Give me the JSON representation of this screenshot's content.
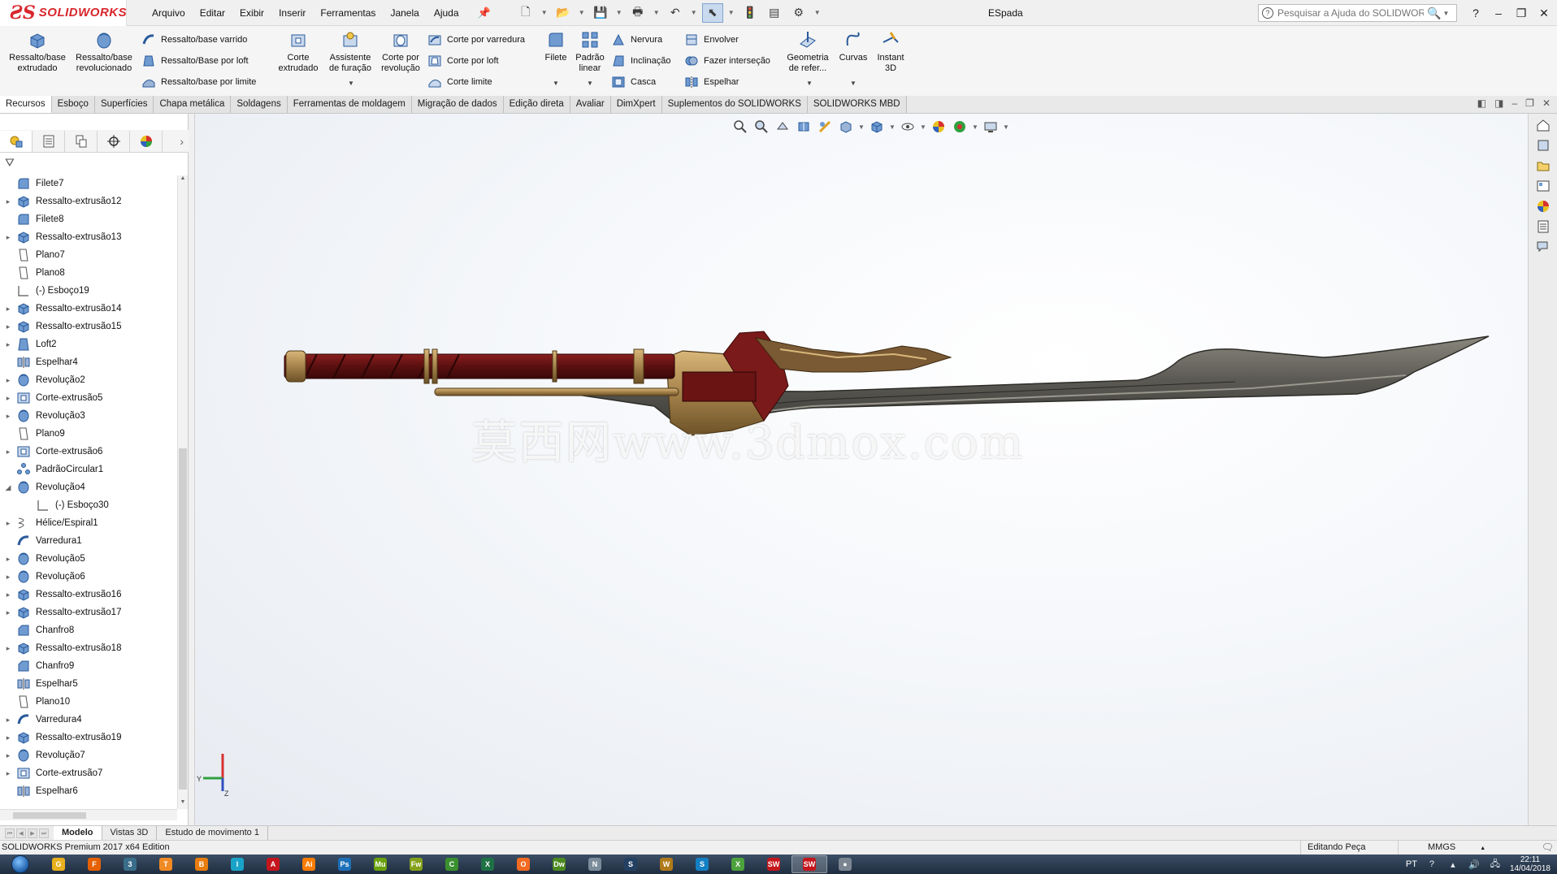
{
  "app": {
    "logo_text": "SOLIDWORKS",
    "document_title": "ESpada",
    "menu": [
      "Arquivo",
      "Editar",
      "Exibir",
      "Inserir",
      "Ferramentas",
      "Janela",
      "Ajuda"
    ],
    "help_search_placeholder": "Pesquisar a Ajuda do SOLIDWORKS"
  },
  "ribbon": {
    "big_buttons": [
      {
        "label": "Ressalto/base extrudado",
        "icon": "extrude-boss-icon"
      },
      {
        "label": "Ressalto/base revolucionado",
        "icon": "revolve-boss-icon"
      },
      {
        "label": "Corte extrudado",
        "icon": "extrude-cut-icon"
      },
      {
        "label": "Assistente de furação",
        "icon": "hole-wizard-icon"
      },
      {
        "label": "Corte por revolução",
        "icon": "revolve-cut-icon"
      },
      {
        "label": "Filete",
        "icon": "fillet-icon"
      },
      {
        "label": "Padrão linear",
        "icon": "linear-pattern-icon"
      },
      {
        "label": "Geometria de refer...",
        "icon": "reference-geometry-icon"
      },
      {
        "label": "Curvas",
        "icon": "curves-icon"
      },
      {
        "label": "Instant 3D",
        "icon": "instant3d-icon"
      }
    ],
    "small_buttons": [
      {
        "label": "Ressalto/base varrido",
        "icon": "swept-boss-icon"
      },
      {
        "label": "Ressalto/Base por loft",
        "icon": "loft-boss-icon"
      },
      {
        "label": "Ressalto/base por limite",
        "icon": "boundary-boss-icon"
      },
      {
        "label": "Corte por varredura",
        "icon": "swept-cut-icon"
      },
      {
        "label": "Corte por loft",
        "icon": "lofted-cut-icon"
      },
      {
        "label": "Corte limite",
        "icon": "boundary-cut-icon"
      },
      {
        "label": "Nervura",
        "icon": "rib-icon"
      },
      {
        "label": "Inclinação",
        "icon": "draft-icon"
      },
      {
        "label": "Casca",
        "icon": "shell-icon"
      },
      {
        "label": "Envolver",
        "icon": "wrap-icon"
      },
      {
        "label": "Fazer interseção",
        "icon": "intersect-icon"
      },
      {
        "label": "Espelhar",
        "icon": "mirror-icon"
      }
    ]
  },
  "tabs": [
    "Recursos",
    "Esboço",
    "Superfícies",
    "Chapa metálica",
    "Soldagens",
    "Ferramentas de moldagem",
    "Migração de dados",
    "Edição direta",
    "Avaliar",
    "DimXpert",
    "Suplementos do SOLIDWORKS",
    "SOLIDWORKS MBD"
  ],
  "active_tab": "Recursos",
  "feature_tree": [
    {
      "label": "Filete7",
      "icon": "fillet",
      "expandable": false
    },
    {
      "label": "Ressalto-extrusão12",
      "icon": "extrude",
      "expandable": true
    },
    {
      "label": "Filete8",
      "icon": "fillet",
      "expandable": false
    },
    {
      "label": "Ressalto-extrusão13",
      "icon": "extrude",
      "expandable": true
    },
    {
      "label": "Plano7",
      "icon": "plane",
      "expandable": false
    },
    {
      "label": "Plano8",
      "icon": "plane",
      "expandable": false
    },
    {
      "label": "(-) Esboço19",
      "icon": "sketch",
      "expandable": false
    },
    {
      "label": "Ressalto-extrusão14",
      "icon": "extrude",
      "expandable": true
    },
    {
      "label": "Ressalto-extrusão15",
      "icon": "extrude",
      "expandable": true
    },
    {
      "label": "Loft2",
      "icon": "loft",
      "expandable": true
    },
    {
      "label": "Espelhar4",
      "icon": "mirror",
      "expandable": false
    },
    {
      "label": "Revolução2",
      "icon": "revolve",
      "expandable": true
    },
    {
      "label": "Corte-extrusão5",
      "icon": "cut",
      "expandable": true
    },
    {
      "label": "Revolução3",
      "icon": "revolve",
      "expandable": true
    },
    {
      "label": "Plano9",
      "icon": "plane",
      "expandable": false
    },
    {
      "label": "Corte-extrusão6",
      "icon": "cut",
      "expandable": true
    },
    {
      "label": "PadrãoCircular1",
      "icon": "pattern",
      "expandable": false
    },
    {
      "label": "Revolução4",
      "icon": "revolve",
      "expandable": true,
      "expanded": true
    },
    {
      "label": "(-) Esboço30",
      "icon": "sketch",
      "expandable": false,
      "child": true
    },
    {
      "label": "Hélice/Espiral1",
      "icon": "helix",
      "expandable": true
    },
    {
      "label": "Varredura1",
      "icon": "sweep",
      "expandable": false
    },
    {
      "label": "Revolução5",
      "icon": "revolve",
      "expandable": true
    },
    {
      "label": "Revolução6",
      "icon": "revolve",
      "expandable": true
    },
    {
      "label": "Ressalto-extrusão16",
      "icon": "extrude",
      "expandable": true
    },
    {
      "label": "Ressalto-extrusão17",
      "icon": "extrude",
      "expandable": true
    },
    {
      "label": "Chanfro8",
      "icon": "chamfer",
      "expandable": false
    },
    {
      "label": "Ressalto-extrusão18",
      "icon": "extrude",
      "expandable": true
    },
    {
      "label": "Chanfro9",
      "icon": "chamfer",
      "expandable": false
    },
    {
      "label": "Espelhar5",
      "icon": "mirror",
      "expandable": false
    },
    {
      "label": "Plano10",
      "icon": "plane",
      "expandable": false
    },
    {
      "label": "Varredura4",
      "icon": "sweep",
      "expandable": true
    },
    {
      "label": "Ressalto-extrusão19",
      "icon": "extrude",
      "expandable": true
    },
    {
      "label": "Revolução7",
      "icon": "revolve",
      "expandable": true
    },
    {
      "label": "Corte-extrusão7",
      "icon": "cut",
      "expandable": true
    },
    {
      "label": "Espelhar6",
      "icon": "mirror",
      "expandable": false
    }
  ],
  "viewport": {
    "watermark": "莫西网www.3dmox.com",
    "triad_labels": {
      "y": "Y",
      "z": "Z"
    }
  },
  "bottom_tabs": [
    "Modelo",
    "Vistas 3D",
    "Estudo de movimento 1"
  ],
  "active_bottom_tab": "Modelo",
  "status": {
    "product": "SOLIDWORKS Premium 2017 x64 Edition",
    "mode": "Editando Peça",
    "units": "MMGS"
  },
  "taskbar": {
    "language": "PT",
    "time": "22:11",
    "date": "14/04/2018",
    "apps": [
      {
        "icon": "chrome-icon",
        "color": "#e8b01c",
        "text": "G"
      },
      {
        "icon": "firefox-icon",
        "color": "#e66000",
        "text": "F"
      },
      {
        "icon": "3dsmax-icon",
        "color": "#3a6d8a",
        "text": "3"
      },
      {
        "icon": "typora-icon",
        "color": "#f08a24",
        "text": "T"
      },
      {
        "icon": "blender-icon",
        "color": "#e87d0d",
        "text": "B"
      },
      {
        "icon": "inventor-icon",
        "color": "#1aa3c8",
        "text": "I"
      },
      {
        "icon": "acrobat-icon",
        "color": "#c4161c",
        "text": "A"
      },
      {
        "icon": "illustrator-icon",
        "color": "#ff7c00",
        "text": "Ai"
      },
      {
        "icon": "photoshop-icon",
        "color": "#1d6fb8",
        "text": "Ps"
      },
      {
        "icon": "muse-icon",
        "color": "#6ba20f",
        "text": "Mu"
      },
      {
        "icon": "fireworks-icon",
        "color": "#85a11a",
        "text": "Fw"
      },
      {
        "icon": "corel-icon",
        "color": "#3a8f2f",
        "text": "C"
      },
      {
        "icon": "excel-icon",
        "color": "#1e7145",
        "text": "X"
      },
      {
        "icon": "origin-icon",
        "color": "#f36a21",
        "text": "O"
      },
      {
        "icon": "dreamweaver-icon",
        "color": "#4b8a20",
        "text": "Dw"
      },
      {
        "icon": "network-icon",
        "color": "#7a8b9a",
        "text": "N"
      },
      {
        "icon": "steam-icon",
        "color": "#234063",
        "text": "S"
      },
      {
        "icon": "wow-icon",
        "color": "#b07a1a",
        "text": "W"
      },
      {
        "icon": "sketchup-icon",
        "color": "#1480c4",
        "text": "S"
      },
      {
        "icon": "xbox-icon",
        "color": "#4ca23c",
        "text": "X"
      },
      {
        "icon": "solidworks-2017-icon",
        "color": "#c4161c",
        "text": "SW"
      },
      {
        "icon": "solidworks-2017-b-icon",
        "color": "#c4161c",
        "text": "SW",
        "active": true
      },
      {
        "icon": "app-gray-icon",
        "color": "#7b8591",
        "text": "●"
      }
    ]
  }
}
